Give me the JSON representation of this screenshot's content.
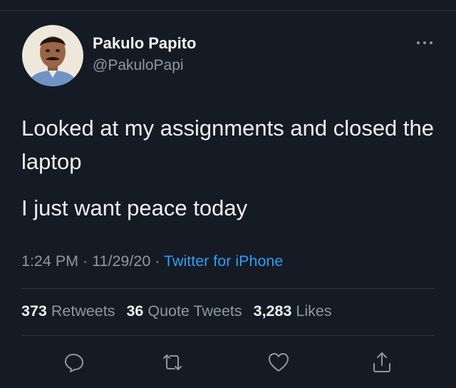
{
  "author": {
    "name": "Pakulo Papito",
    "handle": "@PakuloPapi"
  },
  "tweet": {
    "line1": "Looked at my assignments and closed the laptop",
    "line2": "I just want peace today"
  },
  "meta": {
    "time": "1:24 PM",
    "sep1": " · ",
    "date": "11/29/20",
    "sep2": " · ",
    "source": "Twitter for iPhone"
  },
  "stats": {
    "retweets_count": "373",
    "retweets_label": "Retweets",
    "quotes_count": "36",
    "quotes_label": "Quote Tweets",
    "likes_count": "3,283",
    "likes_label": "Likes"
  },
  "actions": [
    "reply-icon",
    "retweet-icon",
    "like-icon",
    "share-icon"
  ],
  "colors": {
    "background": "#151b24",
    "link": "#2f9df2",
    "muted": "#8b98a5"
  }
}
